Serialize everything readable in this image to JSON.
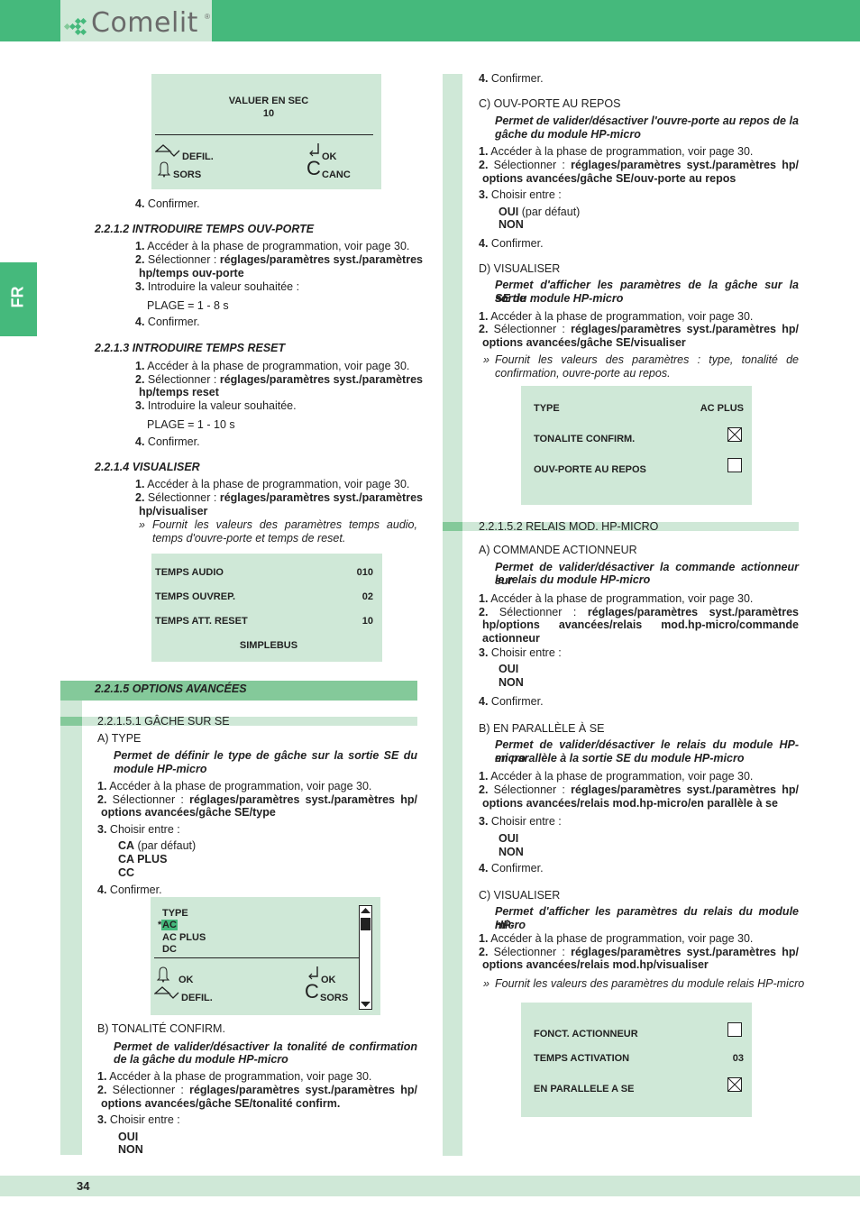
{
  "header": {
    "brand": "Comelit",
    "brand_reg": "®",
    "colors": {
      "accent": "#45b97c",
      "light": "#cfe8d7",
      "mid": "#84c99a"
    }
  },
  "language_tab": "FR",
  "footer": {
    "page_number": "34"
  },
  "left": {
    "lcd1": {
      "title": "VALUER EN SEC",
      "value": "10",
      "keys": {
        "scroll": "DEFIL.",
        "exit": "SORS",
        "ok": "OK",
        "cancel": "CANC"
      }
    },
    "step_confirm": "Confirmer.",
    "s2212": {
      "title": "2.2.1.2 INTRODUIRE TEMPS OUV-PORTE",
      "step1": "Accéder à la phase de programmation, voir page 30.",
      "step2_pre": "Sélectionner : ",
      "step2_path_a": "réglages/paramètres syst./paramètres",
      "step2_path_b": "hp/temps ouv-porte",
      "step3": "Introduire la valeur souhaitée :",
      "range": "PLAGE = 1 - 8 s",
      "step4": "Confirmer."
    },
    "s2213": {
      "title": "2.2.1.3 INTRODUIRE TEMPS RESET",
      "step1": "Accéder à la phase de programmation, voir page 30.",
      "step2_pre": "Sélectionner : ",
      "step2_path_a": "réglages/paramètres syst./paramètres",
      "step2_path_b": "hp/temps reset",
      "step3": "Introduire la valeur souhaitée.",
      "range": "PLAGE = 1 - 10 s",
      "step4": "Confirmer."
    },
    "s2214": {
      "title": "2.2.1.4 VISUALISER",
      "step1": "Accéder à la phase de programmation, voir page 30.",
      "step2_pre": "Sélectionner : ",
      "step2_path_a": "réglages/paramètres syst./paramètres",
      "step2_path_b": "hp/visualiser",
      "note_a": "Fournit les valeurs des paramètres temps audio,",
      "note_b": "temps d'ouvre-porte et temps de reset.",
      "lcd": {
        "rows": [
          {
            "label": "TEMPS AUDIO",
            "value": "010"
          },
          {
            "label": "TEMPS OUVREP.",
            "value": "02"
          },
          {
            "label": "TEMPS ATT. RESET",
            "value": "10"
          }
        ],
        "footer": "SIMPLEBUS"
      }
    },
    "s2215": {
      "title": "2.2.1.5 OPTIONS AVANCÉES"
    },
    "s22151": {
      "title": "2.2.1.5.1 GÂCHE SUR SE",
      "a_title": "A) TYPE",
      "a_desc_a": "Permet de définir le type de gâche sur la sortie SE du",
      "a_desc_b": "module HP-micro",
      "step1": "Accéder à la phase de programmation, voir page 30.",
      "a_step2_pre": "Sélectionner : ",
      "a_step2_path_a": "réglages/paramètres syst./paramètres hp/",
      "a_step2_path_b": "options avancées/gâche SE/type",
      "step3": "Choisir entre :",
      "a_opt1": "CA",
      "a_opt1_note": " (par défaut)",
      "a_opt2": "CA PLUS",
      "a_opt3": "CC",
      "step4": "Confirmer.",
      "lcd": {
        "title": "TYPE",
        "marker": "*",
        "options": [
          "AC",
          "AC PLUS",
          "DC"
        ],
        "selected": "AC",
        "keys": {
          "ok_left": "OK",
          "scroll": "DEFIL.",
          "ok_right": "OK",
          "exit": "SORS"
        }
      },
      "b_title": "B) TONALITÉ CONFIRM.",
      "b_desc_a": "Permet de valider/désactiver la tonalité de confirmation",
      "b_desc_b": "de la gâche du module HP-micro",
      "b_step2_path_a": "réglages/paramètres syst./paramètres hp/",
      "b_step2_path_b": "options avancées/gâche SE/tonalité confirm.",
      "b_opt1": "OUI",
      "b_opt2": "NON"
    }
  },
  "right": {
    "step_confirm": "Confirmer.",
    "c_title": "C) OUV-PORTE AU REPOS",
    "c_desc_a": "Permet de valider/désactiver l'ouvre-porte au repos de la",
    "c_desc_b": "gâche du module HP-micro",
    "step1": "Accéder à la phase de programmation, voir page 30.",
    "step2_pre": "Sélectionner : ",
    "c_path_a": "réglages/paramètres syst./paramètres hp/",
    "c_path_b": "options avancées/gâche SE/ouv-porte au repos",
    "step3": "Choisir entre :",
    "c_opt1": "OUI",
    "c_opt1_note": " (par défaut)",
    "c_opt2": "NON",
    "d_title": "D) VISUALISER",
    "d_desc_a": "Permet d'afficher les paramètres de la gâche sur la sortie",
    "d_desc_b": "SE du module HP-micro",
    "d_path_a": "réglages/paramètres syst./paramètres hp/",
    "d_path_b": "options avancées/gâche SE/visualiser",
    "d_note_a": "Fournit les valeurs des paramètres : type, tonalité de",
    "d_note_b": "confirmation, ouvre-porte au repos.",
    "lcd1": {
      "rows": [
        {
          "label": "TYPE",
          "value": "AC PLUS"
        },
        {
          "label": "TONALITE CONFIRM.",
          "checked": true
        },
        {
          "label": "OUV-PORTE AU REPOS",
          "checked": false
        }
      ]
    },
    "s22152": {
      "title": "2.2.1.5.2 RELAIS MOD. HP-MICRO",
      "a_title": "A) COMMANDE ACTIONNEUR",
      "a_desc_a": "Permet de valider/désactiver la commande actionneur sur",
      "a_desc_b": "le relais du module HP-micro",
      "a_path_a": "réglages/paramètres syst./paramètres",
      "a_path_b": "hp/options avancées/relais mod.hp-micro/commande",
      "a_path_c": "actionneur",
      "opt_yes": "OUI",
      "opt_no": "NON",
      "b_title": "B) EN PARALLÈLE À SE",
      "b_desc_a": "Permet de valider/désactiver le relais du module HP-micro",
      "b_desc_b": "en parallèle à la sortie SE du module HP-micro",
      "b_path_a": "réglages/paramètres syst./paramètres hp/",
      "b_path_b": "options avancées/relais mod.hp-micro/en parallèle à se",
      "c_title": "C) VISUALISER",
      "c_desc_a": "Permet d'afficher les paramètres du relais du module HP-",
      "c_desc_b": "micro",
      "c_path_a": "réglages/paramètres syst./paramètres hp/",
      "c_path_b": "options avancées/relais mod.hp/visualiser",
      "c_note": "Fournit les valeurs des paramètres du module relais HP-micro",
      "lcd": {
        "rows": [
          {
            "label": "FONCT. ACTIONNEUR",
            "checked": false
          },
          {
            "label": "TEMPS ACTIVATION",
            "value": "03"
          },
          {
            "label": "EN PARALLELE A SE",
            "checked": true
          }
        ]
      }
    }
  },
  "numbers": {
    "n1": "1.",
    "n2": "2.",
    "n3": "3.",
    "n4": "4.",
    "bullet": "»"
  }
}
